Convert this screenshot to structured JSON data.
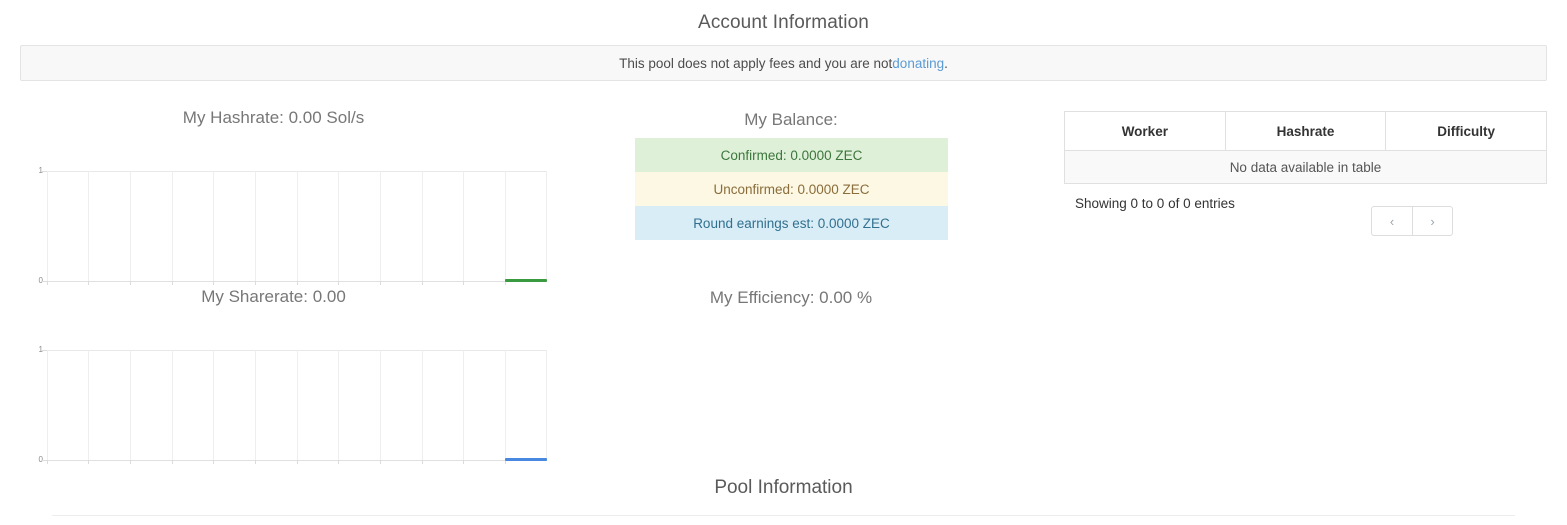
{
  "page": {
    "account_heading": "Account Information",
    "pool_heading": "Pool Information"
  },
  "notice": {
    "text_before": "This pool does not apply fees and you are not ",
    "link_label": "donating",
    "text_after": ".",
    "link_color": "#5b9bd5"
  },
  "charts": [
    {
      "id": "hashrate",
      "title": "My Hashrate: 0.00 Sol/s",
      "color": "#3a9a40"
    },
    {
      "id": "sharerate",
      "title": "My Sharerate: 0.00",
      "color": "#4888e0"
    }
  ],
  "chart_data": [
    {
      "type": "line",
      "title": "My Hashrate: 0.00 Sol/s",
      "xlabel": "",
      "ylabel": "",
      "ylim": [
        0,
        1
      ],
      "yticks": [
        "0",
        "1"
      ],
      "grid": true,
      "legend": "none",
      "series": [
        {
          "name": "My Hashrate",
          "color": "#3a9a40",
          "x": [
            10,
            11
          ],
          "values": [
            0,
            0
          ]
        }
      ],
      "x_gridline_count": 12,
      "note": "Flat zero-valued line drawn only over the final interval of the x-axis"
    },
    {
      "type": "line",
      "title": "My Sharerate: 0.00",
      "xlabel": "",
      "ylabel": "",
      "ylim": [
        0,
        1
      ],
      "yticks": [
        "0",
        "1"
      ],
      "grid": true,
      "legend": "none",
      "series": [
        {
          "name": "My Sharerate",
          "color": "#4888e0",
          "x": [
            10,
            11
          ],
          "values": [
            0,
            0
          ]
        }
      ],
      "x_gridline_count": 12,
      "note": "Flat zero-valued line drawn only over the final interval of the x-axis"
    }
  ],
  "balance": {
    "title": "My Balance:",
    "rows": [
      {
        "label": "Confirmed: 0.0000 ZEC",
        "variant": "confirmed"
      },
      {
        "label": "Unconfirmed: 0.0000 ZEC",
        "variant": "unconfirmed"
      },
      {
        "label": "Round earnings est: 0.0000 ZEC",
        "variant": "round"
      }
    ]
  },
  "efficiency": {
    "title": "My Efficiency: 0.00 %"
  },
  "workers_table": {
    "columns": [
      "Worker",
      "Hashrate",
      "Difficulty"
    ],
    "empty_message": "No data available in table",
    "info": "Showing 0 to 0 of 0 entries",
    "pagination": {
      "prev_label": "‹",
      "next_label": "›"
    }
  }
}
